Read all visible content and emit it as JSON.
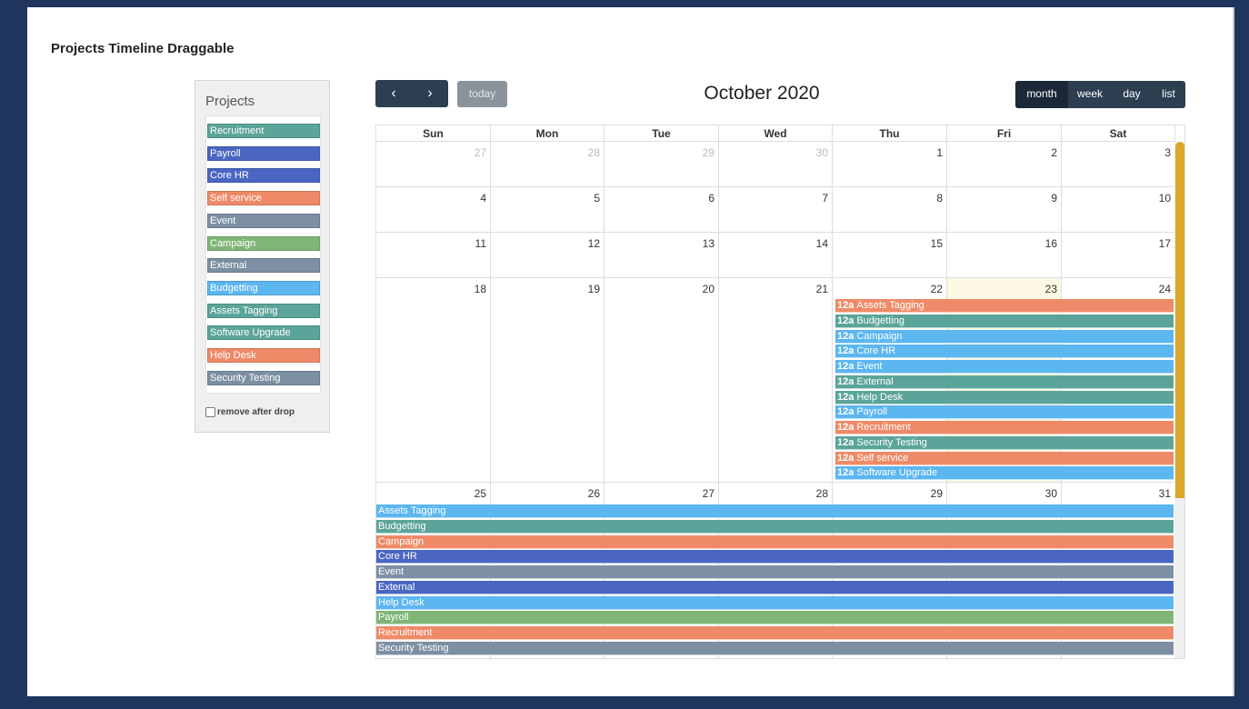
{
  "page": {
    "title": "Projects Timeline Draggable"
  },
  "projects_panel": {
    "heading": "Projects",
    "items": [
      {
        "label": "Recruitment",
        "color": "#5ba49a"
      },
      {
        "label": "Payroll",
        "color": "#4a66c2"
      },
      {
        "label": "Core HR",
        "color": "#4a66c2"
      },
      {
        "label": "Self service",
        "color": "#ef8a68"
      },
      {
        "label": "Event",
        "color": "#7c8fa3"
      },
      {
        "label": "Campaign",
        "color": "#7fb676"
      },
      {
        "label": "External",
        "color": "#7c8fa3"
      },
      {
        "label": "Budgetting",
        "color": "#5cb6ef"
      },
      {
        "label": "Assets Tagging",
        "color": "#5ba49a"
      },
      {
        "label": "Software Upgrade",
        "color": "#5ba49a"
      },
      {
        "label": "Help Desk",
        "color": "#ef8a68"
      },
      {
        "label": "Security Testing",
        "color": "#7c8fa3"
      }
    ],
    "remove_after_drop_label": "remove after drop"
  },
  "toolbar": {
    "prev_icon": "‹",
    "next_icon": "›",
    "today_label": "today",
    "title": "October 2020",
    "views": [
      "month",
      "week",
      "day",
      "list"
    ],
    "active_view": "month"
  },
  "calendar": {
    "days_of_week": [
      "Sun",
      "Mon",
      "Tue",
      "Wed",
      "Thu",
      "Fri",
      "Sat"
    ],
    "weeks": [
      [
        {
          "d": "27",
          "other": true
        },
        {
          "d": "28",
          "other": true
        },
        {
          "d": "29",
          "other": true
        },
        {
          "d": "30",
          "other": true
        },
        {
          "d": "1"
        },
        {
          "d": "2"
        },
        {
          "d": "3"
        }
      ],
      [
        {
          "d": "4"
        },
        {
          "d": "5"
        },
        {
          "d": "6"
        },
        {
          "d": "7"
        },
        {
          "d": "8"
        },
        {
          "d": "9"
        },
        {
          "d": "10"
        }
      ],
      [
        {
          "d": "11"
        },
        {
          "d": "12"
        },
        {
          "d": "13"
        },
        {
          "d": "14"
        },
        {
          "d": "15"
        },
        {
          "d": "16"
        },
        {
          "d": "17"
        }
      ],
      [
        {
          "d": "18"
        },
        {
          "d": "19"
        },
        {
          "d": "20"
        },
        {
          "d": "21"
        },
        {
          "d": "22"
        },
        {
          "d": "23",
          "today": true
        },
        {
          "d": "24"
        }
      ],
      [
        {
          "d": "25"
        },
        {
          "d": "26"
        },
        {
          "d": "27"
        },
        {
          "d": "28"
        },
        {
          "d": "29"
        },
        {
          "d": "30"
        },
        {
          "d": "31"
        }
      ]
    ],
    "today_color": "#fcf8e3",
    "week4_events": [
      {
        "time": "12a",
        "title": "Assets Tagging",
        "color": "#ef8a68"
      },
      {
        "time": "12a",
        "title": "Budgetting",
        "color": "#5ba49a"
      },
      {
        "time": "12a",
        "title": "Campaign",
        "color": "#5cb6ef"
      },
      {
        "time": "12a",
        "title": "Core HR",
        "color": "#5cb6ef"
      },
      {
        "time": "12a",
        "title": "Event",
        "color": "#5cb6ef"
      },
      {
        "time": "12a",
        "title": "External",
        "color": "#5ba49a"
      },
      {
        "time": "12a",
        "title": "Help Desk",
        "color": "#5ba49a"
      },
      {
        "time": "12a",
        "title": "Payroll",
        "color": "#5cb6ef"
      },
      {
        "time": "12a",
        "title": "Recruitment",
        "color": "#ef8a68"
      },
      {
        "time": "12a",
        "title": "Security Testing",
        "color": "#5ba49a"
      },
      {
        "time": "12a",
        "title": "Self service",
        "color": "#ef8a68"
      },
      {
        "time": "12a",
        "title": "Software Upgrade",
        "color": "#5cb6ef"
      }
    ],
    "week5_events": [
      {
        "title": "Assets Tagging",
        "color": "#5cb6ef"
      },
      {
        "title": "Budgetting",
        "color": "#5ba49a"
      },
      {
        "title": "Campaign",
        "color": "#ef8a68"
      },
      {
        "title": "Core HR",
        "color": "#4a66c2"
      },
      {
        "title": "Event",
        "color": "#7c8fa3"
      },
      {
        "title": "External",
        "color": "#4a66c2"
      },
      {
        "title": "Help Desk",
        "color": "#5cb6ef"
      },
      {
        "title": "Payroll",
        "color": "#7fb676"
      },
      {
        "title": "Recruitment",
        "color": "#ef8a68"
      },
      {
        "title": "Security Testing",
        "color": "#7c8fa3"
      }
    ],
    "scrollbar_color": "#d9a82b"
  }
}
